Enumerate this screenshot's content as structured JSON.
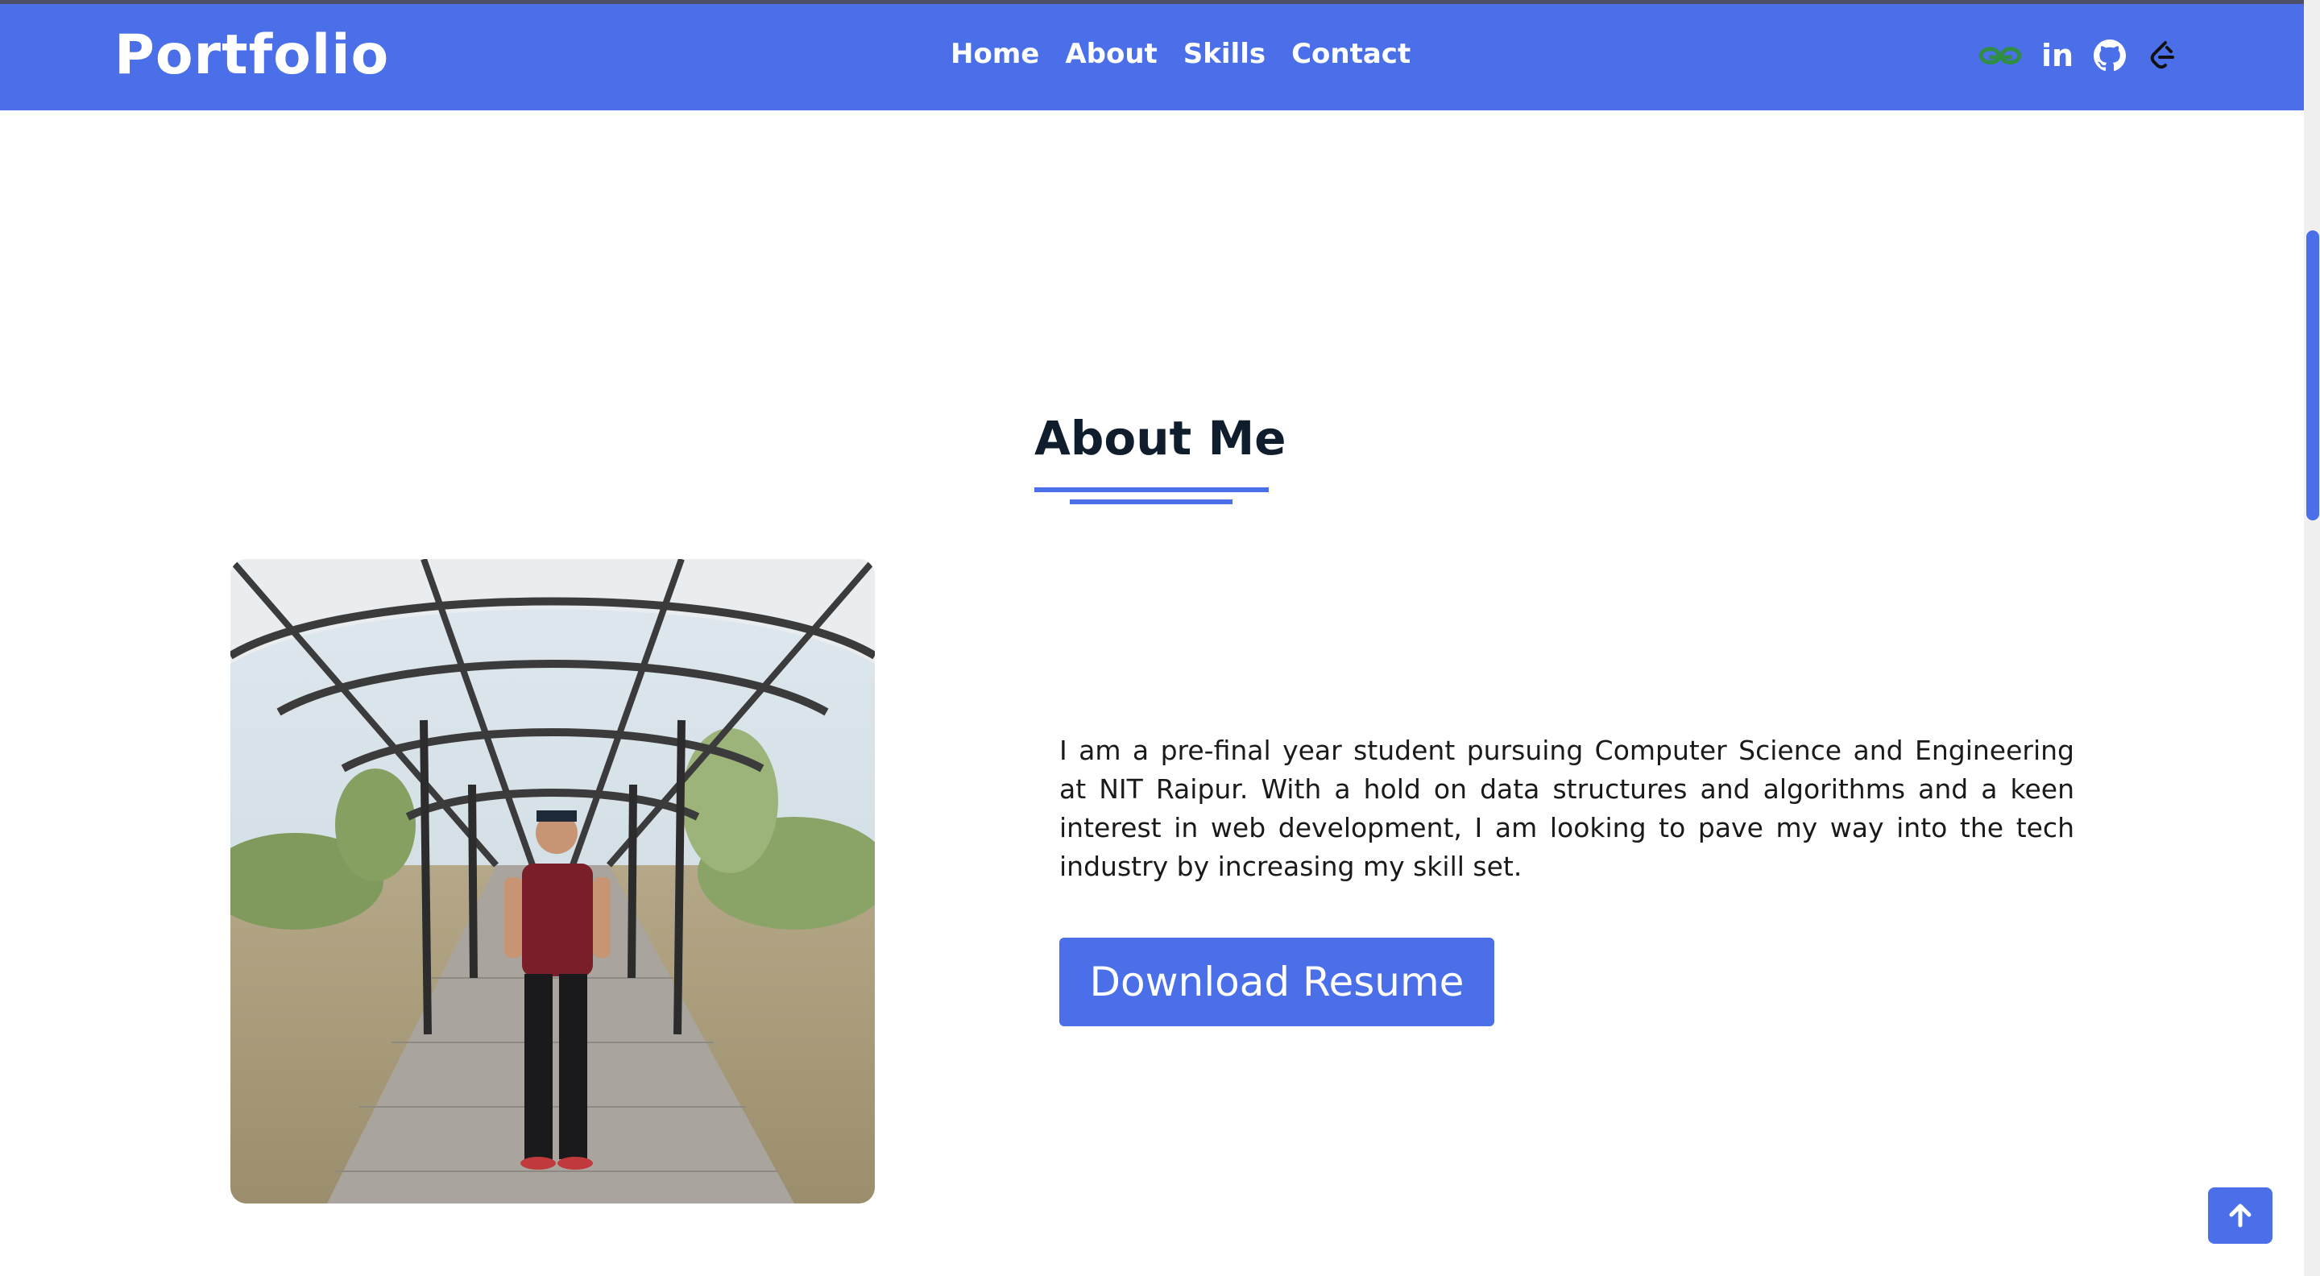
{
  "navbar": {
    "brand": "Portfolio",
    "links": [
      "Home",
      "About",
      "Skills",
      "Contact"
    ],
    "social_icons": [
      "geeksforgeeks-icon",
      "linkedin-icon",
      "github-icon",
      "leetcode-icon"
    ],
    "social_text": {
      "linkedin": "in"
    }
  },
  "about": {
    "title": "About Me",
    "paragraph": "I am a pre-final year student pursuing Computer Science and Engineering at NIT Raipur. With a hold on data structures and algorithms and a keen interest in web development, I am looking to pave my way into the tech industry by increasing my skill set.",
    "download_label": "Download Resume"
  },
  "colors": {
    "accent": "#4a6fe8",
    "heading": "#0f1d2c"
  }
}
